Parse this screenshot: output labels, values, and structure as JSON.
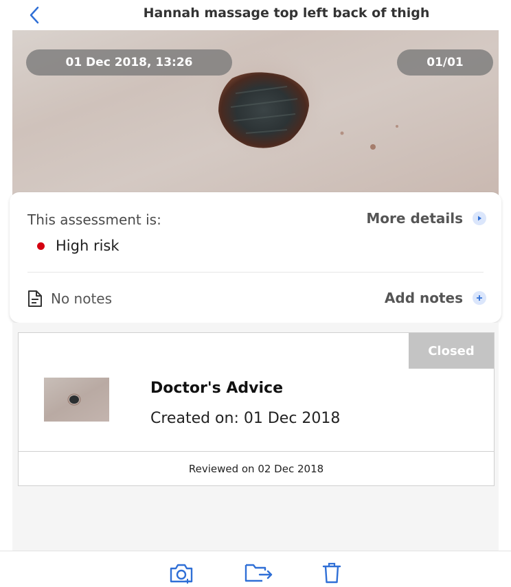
{
  "header": {
    "back_icon": "chevron-left-icon",
    "title": "Hannah massage top left back of thigh"
  },
  "photo": {
    "date_time": "01 Dec 2018, 13:26",
    "counter": "01/01"
  },
  "assessment": {
    "label": "This assessment is:",
    "more_details_label": "More details",
    "more_details_icon": "play-icon",
    "risk_label": "High risk",
    "risk_color": "#d40010",
    "notes_icon": "document-icon",
    "notes_text": "No notes",
    "add_notes_label": "Add notes",
    "add_notes_icon": "plus-icon"
  },
  "advice_card": {
    "status": "Closed",
    "title": "Doctor's Advice",
    "created": "Created on: 01 Dec 2018",
    "reviewed": "Reviewed on 02 Dec 2018"
  },
  "toolbar": {
    "icons": [
      "camera-icon",
      "folder-share-icon",
      "trash-icon"
    ]
  },
  "colors": {
    "accent": "#2f6fd6"
  }
}
